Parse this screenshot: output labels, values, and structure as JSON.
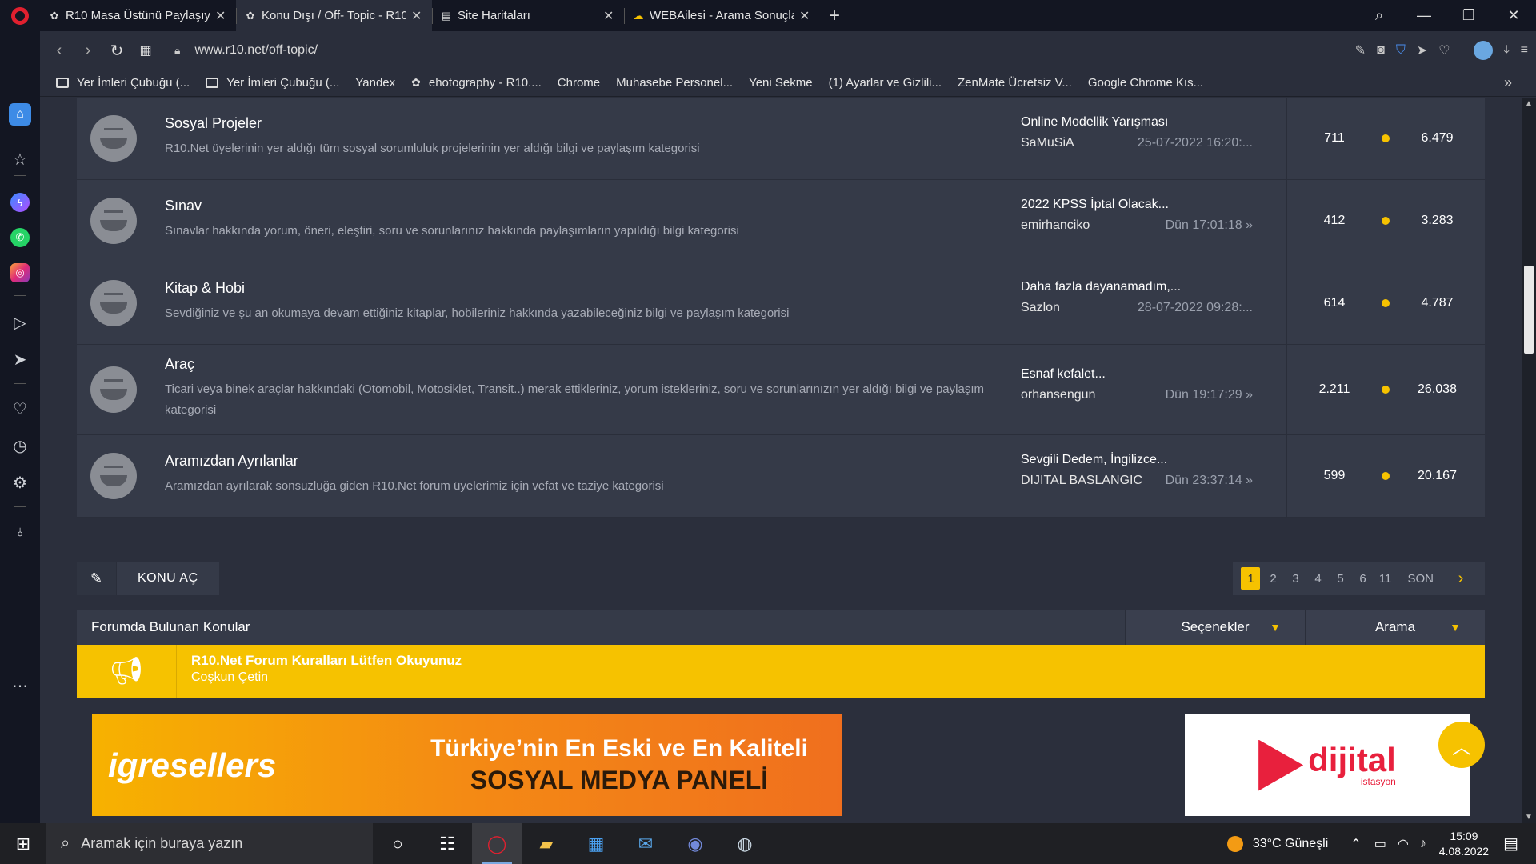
{
  "browser": {
    "tabs": [
      {
        "title": "R10 Masa Üstünü Paylaşıyo",
        "icon": "r10-icon",
        "active": false
      },
      {
        "title": "Konu Dışı / Off- Topic - R10",
        "icon": "r10-icon",
        "active": true
      },
      {
        "title": "Site Haritaları",
        "icon": "sitemap-icon",
        "active": false
      },
      {
        "title": "WEBAilesi - Arama Sonuçla",
        "icon": "webailesi-icon",
        "active": false
      }
    ],
    "url": "www.r10.net/off-topic/",
    "bookmarks": [
      {
        "label": "Yer İmleri Çubuğu (...",
        "icon": "folder"
      },
      {
        "label": "Yer İmleri Çubuğu (...",
        "icon": "folder"
      },
      {
        "label": "Yandex",
        "icon": "page"
      },
      {
        "label": "ehotography - R10....",
        "icon": "cart"
      },
      {
        "label": "Chrome",
        "icon": "page"
      },
      {
        "label": "Muhasebe Personel...",
        "icon": "page"
      },
      {
        "label": "Yeni Sekme",
        "icon": "page"
      },
      {
        "label": "(1) Ayarlar ve Gizlili...",
        "icon": "page"
      },
      {
        "label": "ZenMate Ücretsiz V...",
        "icon": "page"
      },
      {
        "label": "Google Chrome Kıs...",
        "icon": "page"
      }
    ]
  },
  "forums": [
    {
      "title": "Sosyal Projeler",
      "desc": "R10.Net üyelerinin yer aldığı tüm sosyal sorumluluk projelerinin yer aldığı bilgi ve paylaşım kategorisi",
      "last_title": "Online Modellik Yarışması",
      "last_user": "SaMuSiA",
      "last_date": "25-07-2022 16:20:...",
      "topics": "711",
      "posts": "6.479"
    },
    {
      "title": "Sınav",
      "desc": "Sınavlar hakkında yorum, öneri, eleştiri, soru ve sorunlarınız hakkında paylaşımların yapıldığı bilgi kategorisi",
      "last_title": "2022 KPSS İptal Olacak...",
      "last_user": "emirhanciko",
      "last_date": "Dün 17:01:18 »",
      "topics": "412",
      "posts": "3.283"
    },
    {
      "title": "Kitap & Hobi",
      "desc": "Sevdiğiniz ve şu an okumaya devam ettiğiniz kitaplar, hobileriniz hakkında yazabileceğiniz bilgi ve paylaşım kategorisi",
      "last_title": "Daha fazla dayanamadım,...",
      "last_user": "Sazlon",
      "last_date": "28-07-2022 09:28:...",
      "topics": "614",
      "posts": "4.787"
    },
    {
      "title": "Araç",
      "desc": "Ticari veya binek araçlar hakkındaki (Otomobil, Motosiklet, Transit..) merak ettikleriniz, yorum istekleriniz, soru ve sorunlarınızın yer aldığı bilgi ve paylaşım kategorisi",
      "last_title": "Esnaf kefalet...",
      "last_user": "orhansengun",
      "last_date": "Dün 19:17:29 »",
      "topics": "2.211",
      "posts": "26.038"
    },
    {
      "title": "Aramızdan Ayrılanlar",
      "desc": "Aramızdan ayrılarak sonsuzluğa giden R10.Net forum üyelerimiz için vefat ve taziye kategorisi",
      "last_title": "Sevgili Dedem, İngilizce...",
      "last_user": "DIJITAL BASLANGIC",
      "last_date": "Dün 23:37:14 »",
      "topics": "599",
      "posts": "20.167"
    }
  ],
  "new_topic_label": "KONU AÇ",
  "pagination": {
    "pages": [
      "1",
      "2",
      "3",
      "4",
      "5",
      "6",
      "11"
    ],
    "current": "1",
    "last_label": "SON"
  },
  "topics_header": {
    "title": "Forumda Bulunan Konular",
    "options_label": "Seçenekler",
    "search_label": "Arama"
  },
  "sticky": {
    "title": "R10.Net Forum Kuralları Lütfen Okuyunuz",
    "author": "Coşkun Çetin"
  },
  "ads": {
    "left_brand": "igresellers",
    "left_line1": "Türkiye’nin En Eski ve En Kaliteli",
    "left_line2": "SOSYAL MEDYA PANELİ",
    "right_brand": "dijital",
    "right_sub": "istasyon"
  },
  "taskbar": {
    "search_placeholder": "Aramak için buraya yazın",
    "weather": "33°C  Güneşli",
    "time": "15:09",
    "date": "4.08.2022"
  },
  "colors": {
    "accent": "#f6c200",
    "page_bg": "#2b2f3c",
    "row_bg": "#353a48"
  }
}
